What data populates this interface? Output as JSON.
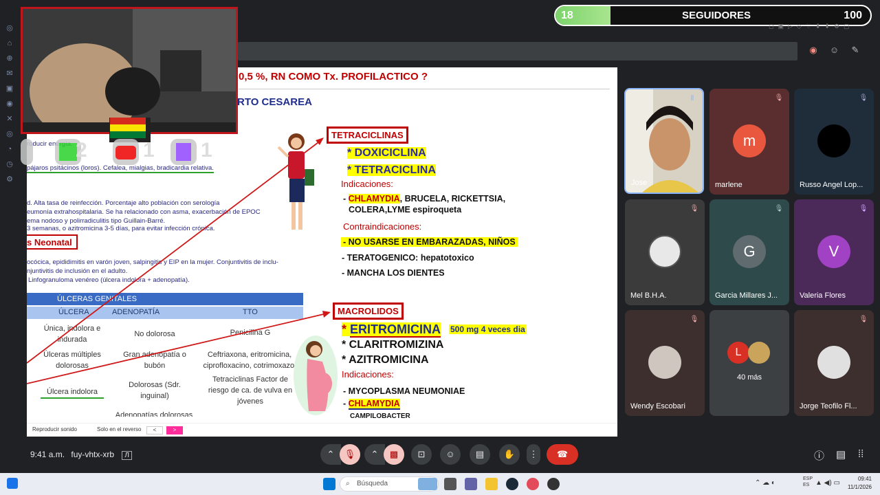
{
  "stream": {
    "followers_current": "18",
    "followers_label": "SEGUIDORES",
    "followers_goal": "100",
    "social": [
      {
        "icon": "kick-icon",
        "count": "2"
      },
      {
        "icon": "youtube-icon",
        "count": "1"
      },
      {
        "icon": "twitch-icon",
        "count": "1"
      }
    ]
  },
  "slide": {
    "header": "0,5 %, RN COMO Tx. PROFILACTICO ?",
    "subheader": "RTO CESAREA",
    "left_lines": [
      "roducir energía.",
      "pájaros psitácinos (loros). Cefalea, mialgias, bradicardia relativa.",
      "d. Alta tasa de reinfección. Porcentaje alto población con serología",
      "eumonía extrahospitalaria. Se ha relacionado con asma, exacerbación de EPOC",
      "ema nodoso y polirradiculitis tipo Guillain-Barré.",
      "3 semanas, o azitromicina 3-5 días, para evitar infección crónica.",
      "ocócica, epididimitis en varón joven, salpingitis y EIP en la mujer. Conjuntivitis de inclu-",
      "njuntivitis de inclusión en el adulto.",
      "Linfogranuloma venéreo (úlcera indolora + adenopatía)."
    ],
    "neonatal_label": "s Neonatal",
    "table": {
      "title": "ÚLCERAS GENITALES",
      "headers": [
        "ÚLCERA",
        "ADENOPATÍA",
        "TTO"
      ],
      "rows": [
        [
          "Única, indolora e indurada",
          "No dolorosa",
          "Penicilina G"
        ],
        [
          "Úlceras múltiples dolorosas",
          "Gran adenopatía o bubón",
          "Ceftriaxona, eritromicina, ciprofloxacino, cotrimoxazol"
        ],
        [
          "Úlcera indolora",
          "Dolorosas (Sdr. inguinal)",
          "Tetraciclinas Factor de riesgo de ca. de vulva en jóvenes"
        ]
      ],
      "partial_row": "Adenopatías dolorosas"
    },
    "tetra": {
      "title": "TETRACICLINAS",
      "drug1": "* DOXICICLINA",
      "drug2": "* TETRACICLINA",
      "ind_label": "Indicaciones:",
      "ind_hl": "CHLAMYDIA",
      "ind_rest1": ", BRUCELA, RICKETTSIA,",
      "ind_rest2": "COLERA,LYME espiroqueta",
      "contra_label": "Contraindicaciones:",
      "contra1": "- NO USARSE EN EMBARAZADAS, NIÑOS",
      "contra2": "- TERATOGENICO: hepatotoxico",
      "contra3": "- MANCHA LOS DIENTES"
    },
    "macro": {
      "title": "MACROLIDOS",
      "drug1": "ERITROMICINA",
      "dose": "500 mg 4 veces dia",
      "drug2": "* CLARITROMIZINA",
      "drug3": "* AZITROMICINA",
      "ind_label": "Indicaciones:",
      "ind1": "- MYCOPLASMA NEUMONIAE",
      "ind2": "CHLAMYDIA",
      "ind3": "CAMPILOBACTER"
    },
    "footer": {
      "sound": "Reproducir sonido",
      "reverse": "Solo en el reverso",
      "prev": "<",
      "next": ">"
    }
  },
  "participants": [
    {
      "name": "Jose",
      "type": "video"
    },
    {
      "name": "marlene",
      "initial": "m",
      "color": "#e8573e"
    },
    {
      "name": "Russo Angel Lop...",
      "initial": "",
      "color": "#000000"
    },
    {
      "name": "Mel B.H.A.",
      "initial": "",
      "color": "#ddd"
    },
    {
      "name": "Garcia Millares J...",
      "initial": "G",
      "color": "#5f6b6f"
    },
    {
      "name": "Valeria Flores",
      "initial": "V",
      "color": "#a142c4"
    },
    {
      "name": "Wendy Escobari",
      "initial": "",
      "color": "#ccc"
    },
    {
      "name": "40 más",
      "initial": "L",
      "color": "#d93025"
    },
    {
      "name": "Jorge Teofilo Fl...",
      "initial": "",
      "color": "#ddd"
    }
  ],
  "meeting": {
    "time": "9:41 a.m.",
    "code": "fuy-vhtx-xrb"
  },
  "taskbar": {
    "search": "Búsqueda",
    "lang": "ESP\nES",
    "clock_time": "09:41",
    "clock_date": "11/1/2026"
  },
  "colors": {
    "accent_red": "#c00000",
    "highlight": "#ffff00",
    "end_call": "#d93025"
  }
}
